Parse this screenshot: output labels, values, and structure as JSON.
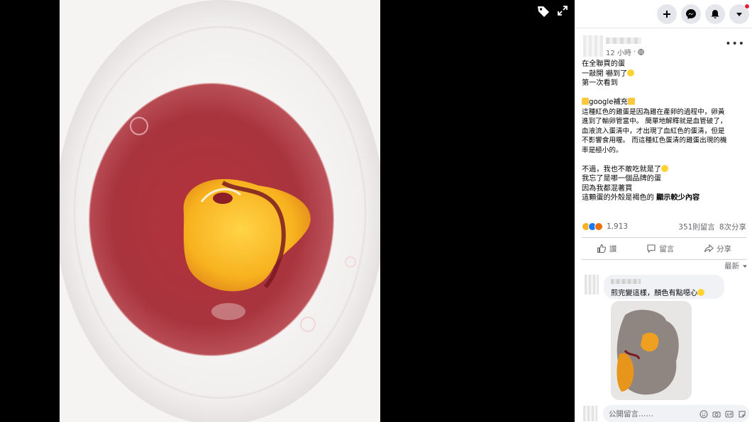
{
  "viewer": {
    "tag_icon": "tag-icon",
    "expand_icon": "fullscreen-expand-icon"
  },
  "topbar": {
    "buttons": [
      "plus-icon",
      "messenger-icon",
      "notifications-bell-icon",
      "account-caret-icon"
    ],
    "accent": "#e41e3f"
  },
  "post": {
    "timestamp": "12 小時",
    "privacy_icon": "globe-icon",
    "lines_a": [
      "在全聯買的蛋",
      "一敲開 嚇到了",
      "第一次看到"
    ],
    "google_line": "google補充",
    "body_lines": [
      "這種紅色的雞蛋是因為雞在產卵的過程中，卵黃",
      "進到了輸卵管當中。 簡單地解釋就是血管破了，",
      "血液流入蛋清中，才出現了血紅色的蛋清，但是",
      "不影響食用喔。 而這種紅色蛋清的雞蛋出現的機",
      "率是極小的。"
    ],
    "lines_b": [
      "不過，我也不敢吃就是了",
      "我忘了是哪一個品牌的蛋",
      "因為我都混著買"
    ],
    "last_line": "這顆蛋的外殼是褐色的 ",
    "see_more": "顯示較少內容"
  },
  "stats": {
    "reactions_count": "1,913",
    "comments": "351則留言",
    "shares": "8次分享"
  },
  "actions": {
    "like": "讚",
    "comment": "留言",
    "share": "分享"
  },
  "sort_label": "最新",
  "comment": {
    "text": "煎完變這樣，顏色有點噁心"
  },
  "composer": {
    "placeholder": "公開留言……"
  },
  "colors": {
    "text_secondary": "#65676b",
    "bubble_bg": "#f0f2f5",
    "like_blue": "#1877f2"
  }
}
